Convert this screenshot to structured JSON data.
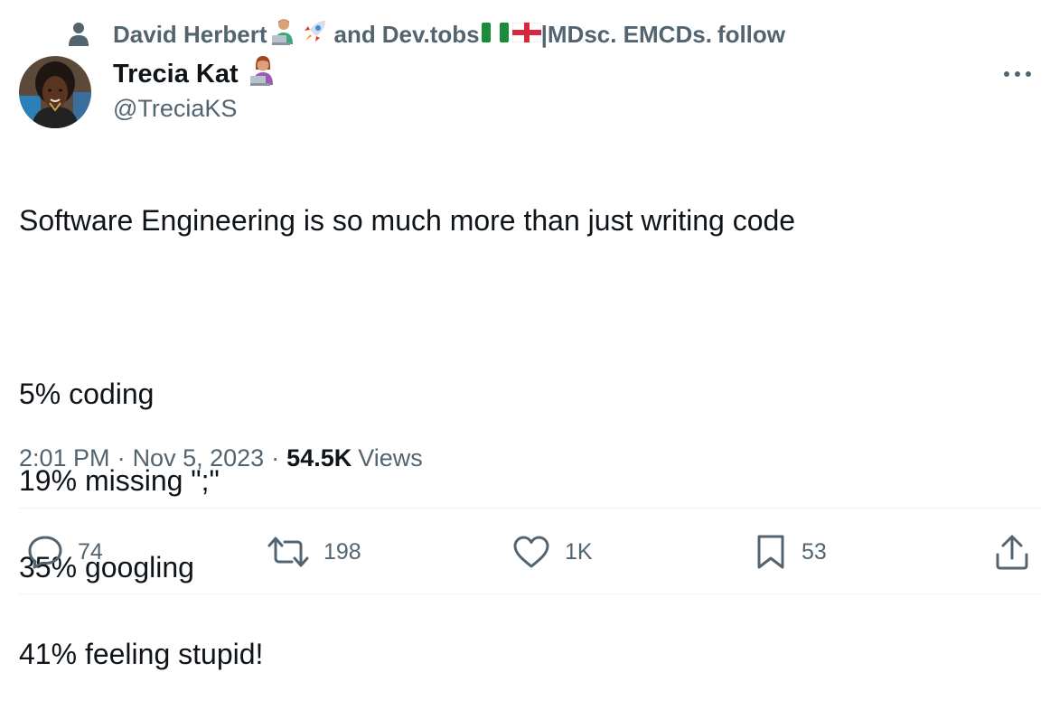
{
  "social_context": {
    "icon": "person-icon",
    "name1": "David Herbert",
    "emoji1": "man-technologist-emoji",
    "emoji2": "rocket-emoji",
    "connector": "and",
    "name2": "Dev.tobs",
    "flag1": "nigeria-flag-emoji",
    "flag2": "england-flag-emoji",
    "suffix": "|MDsc. EMCDs.",
    "action": "follow"
  },
  "author": {
    "display_name": "Trecia Kat",
    "name_emoji": "woman-technologist-emoji",
    "handle": "@TreciaKS",
    "avatar": "avatar"
  },
  "more_icon": "more-icon",
  "tweet": {
    "line1": "Software Engineering is so much more than just writing code",
    "line2": "5% coding",
    "line3": "19% missing \";\"",
    "line4": "35% googling",
    "line5": "41% feeling stupid!"
  },
  "meta": {
    "time": "2:01 PM",
    "separator": "·",
    "date": "Nov 5, 2023",
    "views_count": "54.5K",
    "views_label": "Views"
  },
  "actions": {
    "reply": {
      "icon": "reply-icon",
      "count": "74"
    },
    "repost": {
      "icon": "repost-icon",
      "count": "198"
    },
    "like": {
      "icon": "heart-icon",
      "count": "1K"
    },
    "bookmark": {
      "icon": "bookmark-icon",
      "count": "53"
    },
    "share": {
      "icon": "share-icon"
    }
  },
  "colors": {
    "primary_text": "#0f1419",
    "secondary_text": "#536471",
    "divider": "#eff3f4"
  }
}
